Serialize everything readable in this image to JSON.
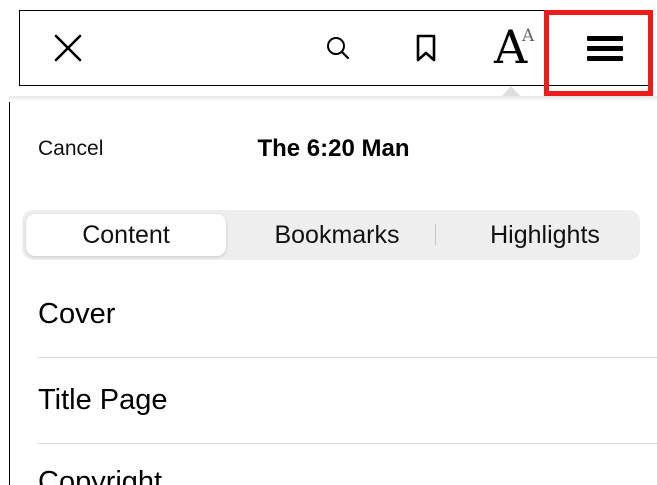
{
  "toolbar": {
    "close_icon": "close-icon",
    "search_icon": "search-icon",
    "bookmark_icon": "bookmark-icon",
    "font_settings": {
      "big": "A",
      "small": "A"
    },
    "menu_icon": "hamburger-menu-icon"
  },
  "highlight_color": "#ee1b1b",
  "panel": {
    "cancel_label": "Cancel",
    "title": "The 6:20 Man",
    "tabs": [
      {
        "label": "Content",
        "selected": true
      },
      {
        "label": "Bookmarks",
        "selected": false
      },
      {
        "label": "Highlights",
        "selected": false
      }
    ],
    "items": [
      {
        "label": "Cover"
      },
      {
        "label": "Title Page"
      },
      {
        "label": "Copyright"
      }
    ]
  }
}
